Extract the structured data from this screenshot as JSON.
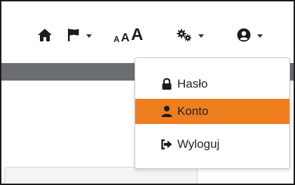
{
  "navbar": {
    "home_icon": "home-icon",
    "language_icon": "flag-icon",
    "font_size_small": "A",
    "font_size_medium": "A",
    "font_size_large": "A",
    "settings_icon": "cogs-icon",
    "user_icon": "user-circle-icon"
  },
  "user_menu": {
    "items": [
      {
        "label": "Hasło",
        "icon": "lock-icon",
        "active": false
      },
      {
        "label": "Konto",
        "icon": "user-icon",
        "active": true
      },
      {
        "label": "Wyloguj",
        "icon": "sign-out-icon",
        "active": false
      }
    ]
  },
  "colors": {
    "active_item": "#ee7e1e",
    "header_bar": "#6b6e71",
    "icon": "#1c1c1c"
  }
}
